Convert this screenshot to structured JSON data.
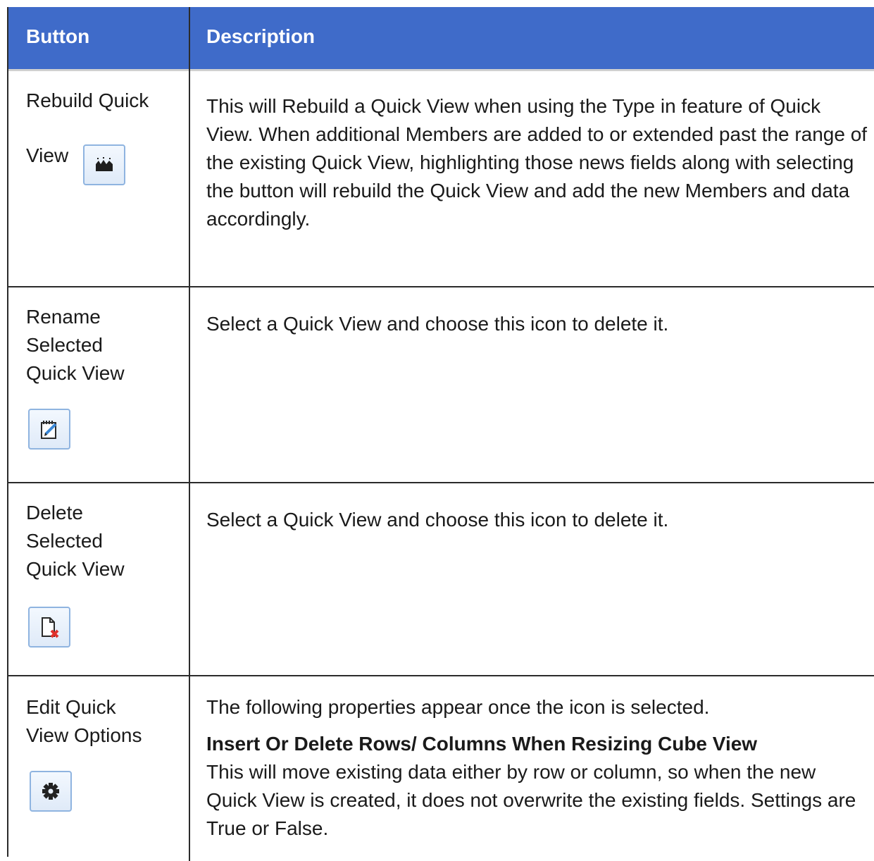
{
  "header": {
    "col_button": "Button",
    "col_description": "Description"
  },
  "rows": [
    {
      "button_lines": [
        "Rebuild Quick",
        "View"
      ],
      "icon": "rebuild-icon",
      "description": "This will Rebuild a Quick View when using the Type in feature of Quick View. When additional Members are added to or extended past the range of the existing Quick View, highlighting those news fields along with selecting the button will rebuild the Quick View and add the new Members and data accordingly."
    },
    {
      "button_lines": [
        "Rename",
        "Selected",
        "Quick View"
      ],
      "icon": "rename-icon",
      "description": "Select a Quick View and choose this icon to delete it."
    },
    {
      "button_lines": [
        "Delete",
        "Selected",
        "Quick View"
      ],
      "icon": "delete-document-icon",
      "description": "Select a Quick View and choose this icon to delete it."
    },
    {
      "button_lines": [
        "Edit Quick",
        "View Options"
      ],
      "icon": "gear-icon",
      "description_intro": "The following properties appear once the icon is selected.",
      "property_title": "Insert Or Delete Rows/ Columns When Resizing Cube View",
      "property_text": "This will move existing data either by row or column, so when the new Quick View is created, it does not overwrite the existing fields. Settings are True or False."
    }
  ],
  "colors": {
    "header_bg": "#3f6bc9",
    "header_text": "#ffffff",
    "border": "#2b2b2b",
    "icon_border": "#8fb4e0",
    "delete_accent": "#e0312b"
  }
}
